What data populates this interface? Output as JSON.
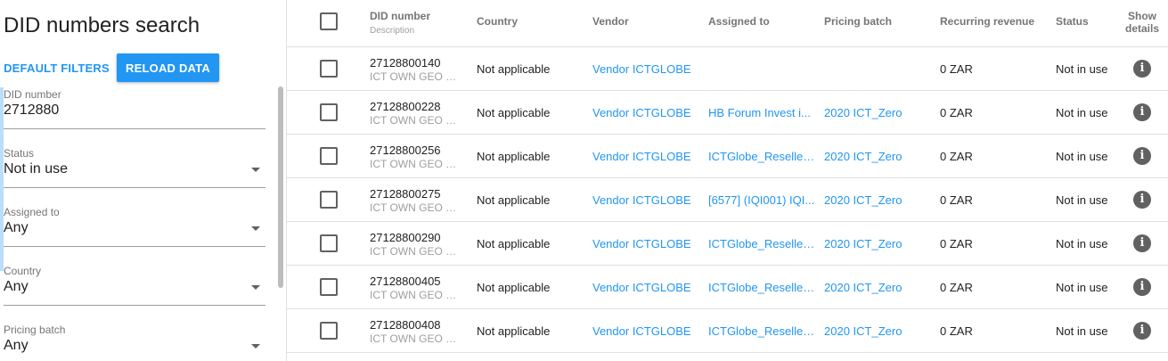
{
  "filters": {
    "title": "DID numbers search",
    "default_filters_label": "DEFAULT FILTERS",
    "reload_label": "RELOAD DATA",
    "did_number": {
      "label": "DID number",
      "value": "2712880"
    },
    "status": {
      "label": "Status",
      "value": "Not in use"
    },
    "assigned_to": {
      "label": "Assigned to",
      "value": "Any"
    },
    "country": {
      "label": "Country",
      "value": "Any"
    },
    "pricing_batch": {
      "label": "Pricing batch",
      "value": "Any"
    }
  },
  "table": {
    "headers": {
      "did": "DID number",
      "did_sub": "Description",
      "country": "Country",
      "vendor": "Vendor",
      "assigned": "Assigned to",
      "pricing": "Pricing batch",
      "revenue": "Recurring revenue",
      "status": "Status",
      "details_1": "Show",
      "details_2": "details"
    },
    "info_icon": "info-icon",
    "rows": [
      {
        "did": "27128800140",
        "desc": "ICT OWN GEO Nu...",
        "country": "Not applicable",
        "vendor": "Vendor ICTGLOBE",
        "assigned": "",
        "pricing": "",
        "revenue": "0 ZAR",
        "status": "Not in use"
      },
      {
        "did": "27128800228",
        "desc": "ICT OWN GEO Nu...",
        "country": "Not applicable",
        "vendor": "Vendor ICTGLOBE",
        "assigned": "HB Forum Invest i...",
        "pricing": "2020 ICT_Zero",
        "revenue": "0 ZAR",
        "status": "Not in use"
      },
      {
        "did": "27128800256",
        "desc": "ICT OWN GEO Nu...",
        "country": "Not applicable",
        "vendor": "Vendor ICTGLOBE",
        "assigned": "ICTGlobe_Reseller...",
        "pricing": "2020 ICT_Zero",
        "revenue": "0 ZAR",
        "status": "Not in use"
      },
      {
        "did": "27128800275",
        "desc": "ICT OWN GEO Nu...",
        "country": "Not applicable",
        "vendor": "Vendor ICTGLOBE",
        "assigned": "[6577] (IQI001) IQI...",
        "pricing": "2020 ICT_Zero",
        "revenue": "0 ZAR",
        "status": "Not in use"
      },
      {
        "did": "27128800290",
        "desc": "ICT OWN GEO Nu...",
        "country": "Not applicable",
        "vendor": "Vendor ICTGLOBE",
        "assigned": "ICTGlobe_Reseller...",
        "pricing": "2020 ICT_Zero",
        "revenue": "0 ZAR",
        "status": "Not in use"
      },
      {
        "did": "27128800405",
        "desc": "ICT OWN GEO Nu...",
        "country": "Not applicable",
        "vendor": "Vendor ICTGLOBE",
        "assigned": "ICTGlobe_Reseller...",
        "pricing": "2020 ICT_Zero",
        "revenue": "0 ZAR",
        "status": "Not in use"
      },
      {
        "did": "27128800408",
        "desc": "ICT OWN GEO Nu...",
        "country": "Not applicable",
        "vendor": "Vendor ICTGLOBE",
        "assigned": "ICTGlobe_Reseller...",
        "pricing": "2020 ICT_Zero",
        "revenue": "0 ZAR",
        "status": "Not in use"
      }
    ]
  },
  "colors": {
    "accent": "#2196f3",
    "text": "#212121",
    "muted": "#757575",
    "divider": "#e0e0e0",
    "icon": "#616161"
  }
}
